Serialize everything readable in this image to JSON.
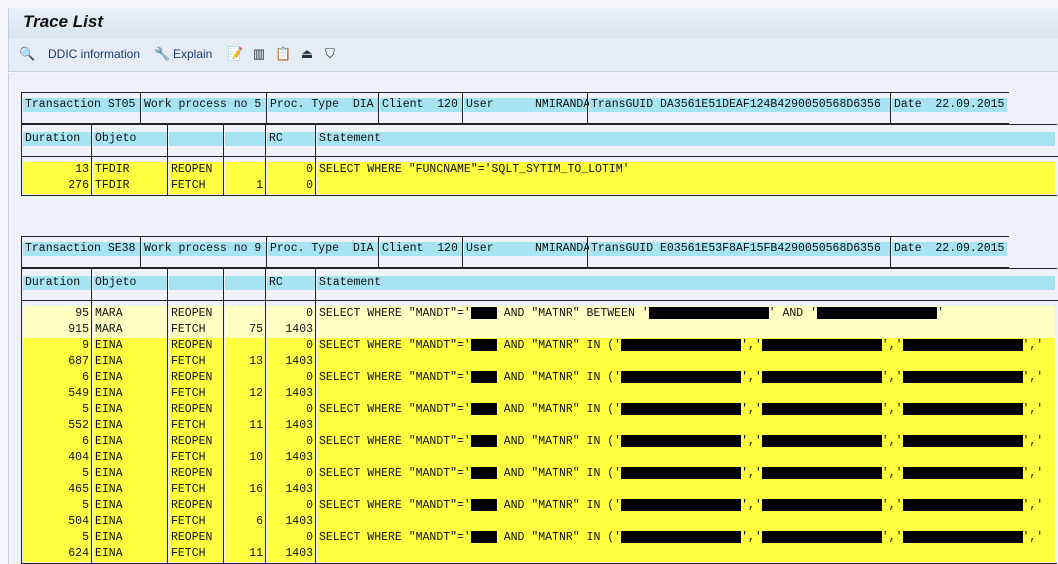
{
  "title": "Trace List",
  "toolbar": {
    "ddic_label": "DDIC information",
    "explain_label": "Explain",
    "icons": [
      "ddic-search-icon",
      "explain-wrench-icon",
      "document-edit-icon",
      "columns-layout-icon",
      "clipboard-icon",
      "print-icon",
      "filter-shield-icon"
    ]
  },
  "colors": {
    "header_cyan": "#a6e4f2",
    "row_yellow": "#ffff40",
    "row_pale_yellow": "#ffffc4"
  },
  "columns": {
    "duration": "Duration",
    "objeto": "Objeto",
    "op": "",
    "count": "",
    "rc": "RC",
    "statement": "Statement"
  },
  "traces": [
    {
      "header": {
        "transaction": "Transaction ST05",
        "work_process": "Work process no 5",
        "proc_type": "Proc. Type  DIA",
        "client": "Client  120",
        "user": "User      NMIRANDA",
        "trans_guid": "TransGUID DA3561E51DEAF124B4290050568D6356",
        "date": "Date  22.09.2015"
      },
      "rows": [
        {
          "duration": "13",
          "objeto": "TFDIR",
          "op": "REOPEN",
          "count": "",
          "rc": "0",
          "shade": "bright",
          "statement": [
            {
              "text": "SELECT WHERE \"FUNCNAME\"='SQLT_SYTIM_TO_LOTIM'"
            }
          ]
        },
        {
          "duration": "276",
          "objeto": "TFDIR",
          "op": "FETCH",
          "count": "1",
          "rc": "0",
          "shade": "bright",
          "statement": []
        }
      ]
    },
    {
      "header": {
        "transaction": "Transaction SE38",
        "work_process": "Work process no 9",
        "proc_type": "Proc. Type  DIA",
        "client": "Client  120",
        "user": "User      NMIRANDA",
        "trans_guid": "TransGUID E03561E53F8AF15FB4290050568D6356",
        "date": "Date  22.09.2015"
      },
      "rows": [
        {
          "duration": "95",
          "objeto": "MARA",
          "op": "REOPEN",
          "count": "",
          "rc": "0",
          "shade": "pale",
          "statement": [
            {
              "text": "SELECT WHERE \"MANDT\"='"
            },
            {
              "redacted": "short"
            },
            {
              "text": " AND \"MATNR\" BETWEEN '"
            },
            {
              "redacted": "long"
            },
            {
              "text": "' AND '"
            },
            {
              "redacted": "long"
            },
            {
              "text": "'"
            }
          ]
        },
        {
          "duration": "915",
          "objeto": "MARA",
          "op": "FETCH",
          "count": "75",
          "rc": "1403",
          "shade": "pale",
          "statement": []
        },
        {
          "duration": "9",
          "objeto": "EINA",
          "op": "REOPEN",
          "count": "",
          "rc": "0",
          "shade": "bright",
          "statement": "IN"
        },
        {
          "duration": "687",
          "objeto": "EINA",
          "op": "FETCH",
          "count": "13",
          "rc": "1403",
          "shade": "bright",
          "statement": []
        },
        {
          "duration": "6",
          "objeto": "EINA",
          "op": "REOPEN",
          "count": "",
          "rc": "0",
          "shade": "bright",
          "statement": "IN"
        },
        {
          "duration": "549",
          "objeto": "EINA",
          "op": "FETCH",
          "count": "12",
          "rc": "1403",
          "shade": "bright",
          "statement": []
        },
        {
          "duration": "5",
          "objeto": "EINA",
          "op": "REOPEN",
          "count": "",
          "rc": "0",
          "shade": "bright",
          "statement": "IN"
        },
        {
          "duration": "552",
          "objeto": "EINA",
          "op": "FETCH",
          "count": "11",
          "rc": "1403",
          "shade": "bright",
          "statement": []
        },
        {
          "duration": "6",
          "objeto": "EINA",
          "op": "REOPEN",
          "count": "",
          "rc": "0",
          "shade": "bright",
          "statement": "IN"
        },
        {
          "duration": "404",
          "objeto": "EINA",
          "op": "FETCH",
          "count": "10",
          "rc": "1403",
          "shade": "bright",
          "statement": []
        },
        {
          "duration": "5",
          "objeto": "EINA",
          "op": "REOPEN",
          "count": "",
          "rc": "0",
          "shade": "bright",
          "statement": "IN"
        },
        {
          "duration": "465",
          "objeto": "EINA",
          "op": "FETCH",
          "count": "16",
          "rc": "1403",
          "shade": "bright",
          "statement": []
        },
        {
          "duration": "5",
          "objeto": "EINA",
          "op": "REOPEN",
          "count": "",
          "rc": "0",
          "shade": "bright",
          "statement": "IN"
        },
        {
          "duration": "504",
          "objeto": "EINA",
          "op": "FETCH",
          "count": "6",
          "rc": "1403",
          "shade": "bright",
          "statement": []
        },
        {
          "duration": "5",
          "objeto": "EINA",
          "op": "REOPEN",
          "count": "",
          "rc": "0",
          "shade": "bright",
          "statement": "IN"
        },
        {
          "duration": "624",
          "objeto": "EINA",
          "op": "FETCH",
          "count": "11",
          "rc": "1403",
          "shade": "bright",
          "statement": []
        }
      ]
    }
  ],
  "statement_in_template": [
    {
      "text": "SELECT WHERE \"MANDT\"='"
    },
    {
      "redacted": "short"
    },
    {
      "text": " AND \"MATNR\" IN ('"
    },
    {
      "redacted": "long"
    },
    {
      "text": "','"
    },
    {
      "redacted": "long"
    },
    {
      "text": "','"
    },
    {
      "redacted": "long"
    },
    {
      "text": "','"
    }
  ]
}
